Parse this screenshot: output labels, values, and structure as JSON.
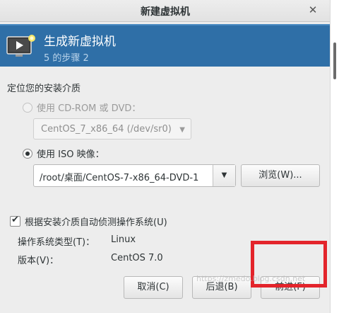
{
  "window": {
    "title": "新建虚拟机",
    "close_glyph": "✕"
  },
  "banner": {
    "title": "生成新虚拟机",
    "step": "5 的步骤 2",
    "icon": "vm-monitor-icon"
  },
  "install_media": {
    "section_label": "定位您的安装介质",
    "cdrom_option": {
      "label": "使用 CD-ROM 或 DVD：",
      "selected": false,
      "enabled": false
    },
    "cdrom_select": {
      "value": "CentOS_7_x86_64 (/dev/sr0)",
      "arrow": "▼"
    },
    "iso_option": {
      "label": "使用 ISO 映像：",
      "selected": true
    },
    "iso_path": {
      "value": "/root/桌面/CentOS-7-x86_64-DVD-1",
      "arrow": "▼"
    },
    "browse_button": "浏览(W)..."
  },
  "autodetect": {
    "label": "根据安装介质自动侦测操作系统(U)",
    "checked": true,
    "os_type_label": "操作系统类型(T)：",
    "os_type_value": "Linux",
    "version_label": "版本(V)：",
    "version_value": "CentOS 7.0"
  },
  "footer": {
    "cancel": "取消(C)",
    "back": "后退(B)",
    "forward": "前进(F)"
  },
  "annotation": {
    "highlight_color": "#e3242b",
    "watermark": "https://zmedo.blog.csdn.net"
  },
  "colors": {
    "banner_bg": "#2f6fa7",
    "content_bg": "#ededed"
  }
}
